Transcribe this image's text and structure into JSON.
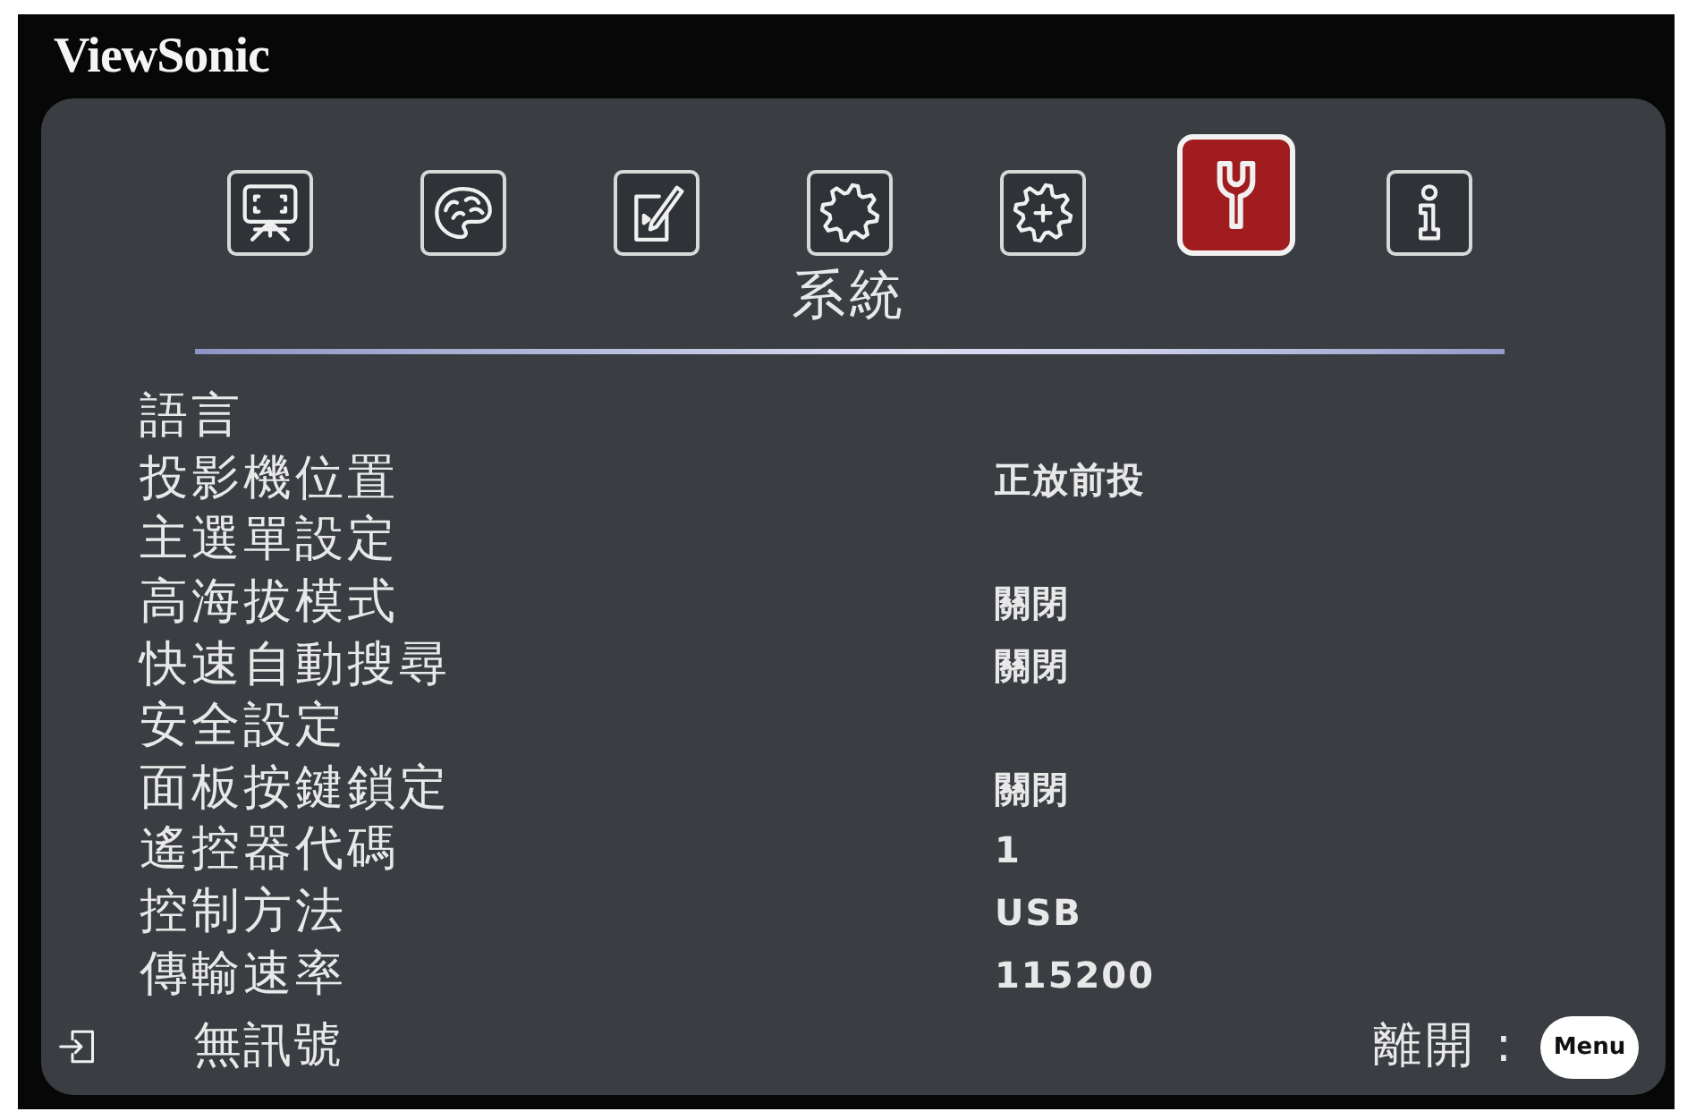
{
  "brand": "ViewSonic",
  "tabs": [
    {
      "kind": "screen",
      "selected": false
    },
    {
      "kind": "palette",
      "selected": false
    },
    {
      "kind": "document",
      "selected": false
    },
    {
      "kind": "gear",
      "selected": false
    },
    {
      "kind": "gear-plus",
      "selected": false
    },
    {
      "kind": "wrench",
      "selected": true
    },
    {
      "kind": "info",
      "selected": false
    }
  ],
  "section_title": "系統",
  "settings": [
    {
      "label": "語言"
    },
    {
      "label": "投影機位置",
      "value": "正放前投"
    },
    {
      "label": "主選單設定"
    },
    {
      "label": "高海拔模式",
      "value": "關閉"
    },
    {
      "label": "快速自動搜尋",
      "value": "關閉"
    },
    {
      "label": "安全設定"
    },
    {
      "label": "面板按鍵鎖定",
      "value": "關閉"
    },
    {
      "label": "遙控器代碼",
      "value": "1"
    },
    {
      "label": "控制方法",
      "value": "USB"
    },
    {
      "label": "傳輸速率",
      "value": "115200"
    }
  ],
  "footer": {
    "status": "無訊號",
    "exit_label": "離開 :",
    "exit_key": "Menu"
  }
}
